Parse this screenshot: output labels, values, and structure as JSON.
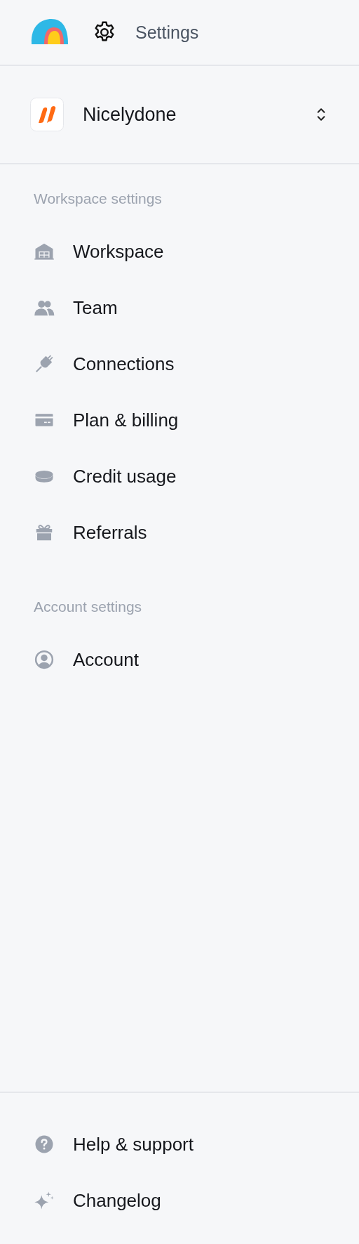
{
  "header": {
    "title": "Settings"
  },
  "workspace_switcher": {
    "name": "Nicelydone"
  },
  "sections": [
    {
      "label": "Workspace settings",
      "items": [
        {
          "label": "Workspace",
          "kind": "building"
        },
        {
          "label": "Team",
          "kind": "team"
        },
        {
          "label": "Connections",
          "kind": "plug"
        },
        {
          "label": "Plan & billing",
          "kind": "card"
        },
        {
          "label": "Credit usage",
          "kind": "coin"
        },
        {
          "label": "Referrals",
          "kind": "gift"
        }
      ]
    },
    {
      "label": "Account settings",
      "items": [
        {
          "label": "Account",
          "kind": "user"
        }
      ]
    }
  ],
  "footer_items": [
    {
      "label": "Help & support",
      "kind": "help"
    },
    {
      "label": "Changelog",
      "kind": "sparkle"
    }
  ]
}
